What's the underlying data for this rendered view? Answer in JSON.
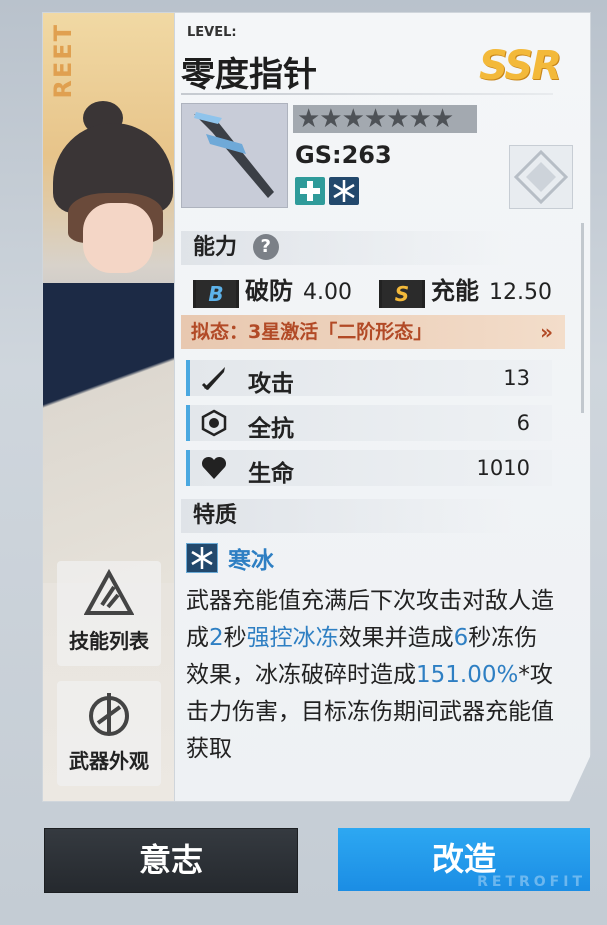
{
  "weapon": {
    "level_label": "LEVEL:",
    "name": "零度指针",
    "rarity": "SSR",
    "stars": "★★★★★★★",
    "gs": "GS:263"
  },
  "side_buttons": {
    "skills": "技能列表",
    "appearance": "武器外观"
  },
  "portrait": {
    "vertical_text": "REET"
  },
  "ability": {
    "title": "能力",
    "help": "?",
    "breaking": {
      "badge": "B",
      "label": "破防",
      "value": "4.00"
    },
    "charge": {
      "badge": "S",
      "label": "充能",
      "value": "12.50"
    },
    "mimic": "拟态：3星激活「二阶形态」",
    "mimic_arrow": "»"
  },
  "stats": [
    {
      "label": "攻击",
      "value": "13",
      "icon": "sword-icon"
    },
    {
      "label": "全抗",
      "value": "6",
      "icon": "shield-ring-icon"
    },
    {
      "label": "生命",
      "value": "1010",
      "icon": "heart-icon"
    }
  ],
  "trait": {
    "title": "特质",
    "name": "寒冰",
    "desc": {
      "p1": "武器充能值充满后下次攻击对敌人造成",
      "h1": "2",
      "p2": "秒",
      "h2": "强控冰冻",
      "p3": "效果并造成",
      "h3": "6",
      "p4": "秒冻伤效果，冰冻破碎时造成",
      "h4": "151.00%",
      "p5": "*攻击力伤害，目标冻伤期间武器充能值获取"
    }
  },
  "buttons": {
    "will": "意志",
    "retrofit": "改造",
    "retrofit_watermark": "RETROFIT"
  },
  "colors": {
    "accent_blue": "#2e7fc3",
    "rarity_gold": "#f3b93a",
    "mimic_text": "#b24a26"
  }
}
